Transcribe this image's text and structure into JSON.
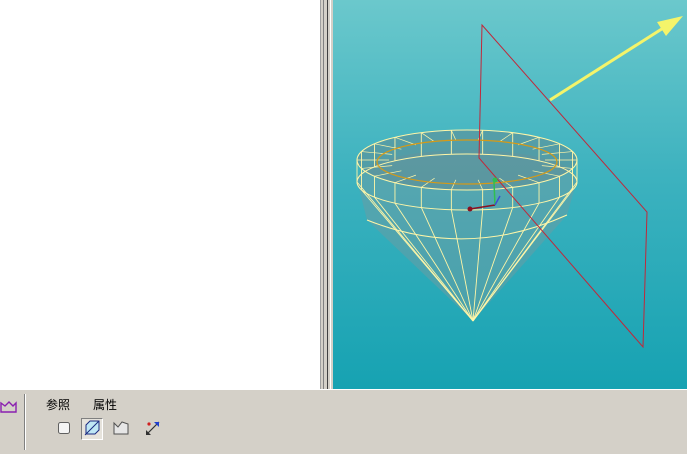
{
  "dashboard": {
    "tabs": [
      {
        "label": "参照"
      },
      {
        "label": "属性"
      }
    ],
    "tools": [
      {
        "icon": "square-surface-icon",
        "pressed": false
      },
      {
        "icon": "cut-surface-icon",
        "pressed": true
      },
      {
        "icon": "open-surface-icon",
        "pressed": false
      },
      {
        "icon": "flip-direction-icon",
        "pressed": false
      }
    ],
    "left_tool_icon": "surface-feature-icon"
  },
  "viewport": {
    "background_top": "#6bc8cc",
    "background_bottom": "#16a2b2",
    "wireframe_color": "#fff6a8",
    "datum_plane_color": "#c0283a",
    "sketch_circle_color": "#d49a18",
    "arrow_color": "#f4f46a"
  }
}
